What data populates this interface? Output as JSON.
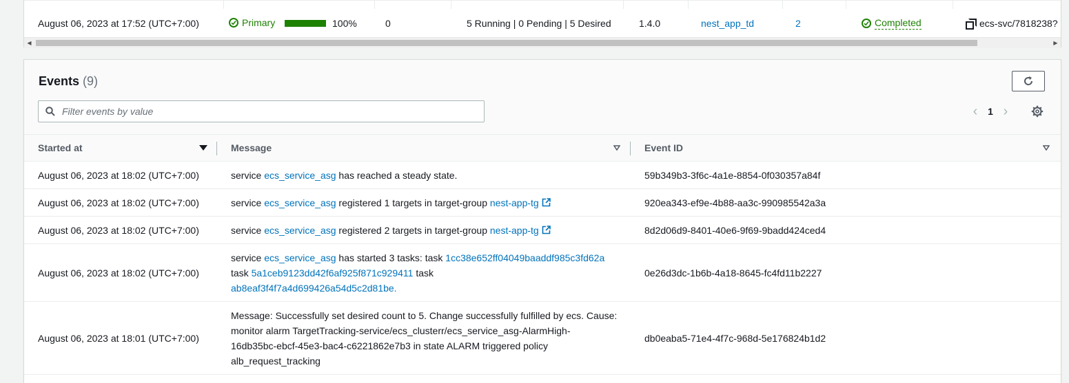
{
  "deployment_row": {
    "created_at": "August 06, 2023 at 17:52 (UTC+7:00)",
    "deployment_status": "Primary",
    "progress_percent": 100,
    "progress_label": "100%",
    "failed_tasks": "0",
    "tasks_summary": "5 Running | 0 Pending | 5 Desired",
    "platform_version": "1.4.0",
    "task_definition": "nest_app_td",
    "revision": "2",
    "rollout_state": "Completed",
    "deployment_id": "ecs-svc/7818238?"
  },
  "events": {
    "title": "Events",
    "count": "(9)",
    "filter_placeholder": "Filter events by value",
    "filter_value": "",
    "current_page": "1",
    "columns": {
      "started_at": "Started at",
      "message": "Message",
      "event_id": "Event ID"
    },
    "rows": [
      {
        "started_at": "August 06, 2023 at 18:02 (UTC+7:00)",
        "msg_prefix": "service",
        "msg_service": "ecs_service_asg",
        "msg_rest": "has reached a steady state.",
        "event_id": "59b349b3-3f6c-4a1e-8854-0f030357a84f"
      },
      {
        "started_at": "August 06, 2023 at 18:02 (UTC+7:00)",
        "msg_prefix": "service",
        "msg_service": "ecs_service_asg",
        "msg_rest": "registered 1 targets in target-group",
        "msg_target_group": "nest-app-tg",
        "event_id": "920ea343-ef9e-4b88-aa3c-990985542a3a"
      },
      {
        "started_at": "August 06, 2023 at 18:02 (UTC+7:00)",
        "msg_prefix": "service",
        "msg_service": "ecs_service_asg",
        "msg_rest": "registered 2 targets in target-group",
        "msg_target_group": "nest-app-tg",
        "event_id": "8d2d06d9-8401-40e6-9f69-9badd424ced4"
      },
      {
        "started_at": "August 06, 2023 at 18:02 (UTC+7:00)",
        "msg_prefix": "service",
        "msg_service": "ecs_service_asg",
        "msg_rest": "has started 3 tasks: task",
        "task_word": "task",
        "task_1": "1cc38e652ff04049baaddf985c3fd62a",
        "task_2": "5a1ceb9123dd42f6af925f871c929411",
        "task_3": "ab8eaf3f4f7a4d699426a54d5c2d81be.",
        "event_id": "0e26d3dc-1b6b-4a18-8645-fc4fd11b2227"
      },
      {
        "started_at": "August 06, 2023 at 18:01 (UTC+7:00)",
        "message_line_1": "Message: Successfully set desired count to 5. Change successfully fulfilled by ecs. Cause:",
        "message_line_2": "monitor alarm TargetTracking-service/ecs_clusterr/ecs_service_asg-AlarmHigh-",
        "message_line_3": "16db35bc-ebcf-45e3-bac4-c6221862e7b3 in state ALARM triggered policy",
        "message_line_4": "alb_request_tracking",
        "event_id": "db0eaba5-71e4-4f7c-968d-5e176824b1d2"
      }
    ]
  },
  "colors": {
    "link": "#0073bb",
    "success": "#1d8102",
    "text": "#16191f",
    "muted": "#687078"
  },
  "icons": [
    "check-circle-icon",
    "copy-icon",
    "refresh-icon",
    "search-icon",
    "chevron-left-icon",
    "chevron-right-icon",
    "settings-icon",
    "sort-desc-icon",
    "sort-icon",
    "external-link-icon"
  ]
}
